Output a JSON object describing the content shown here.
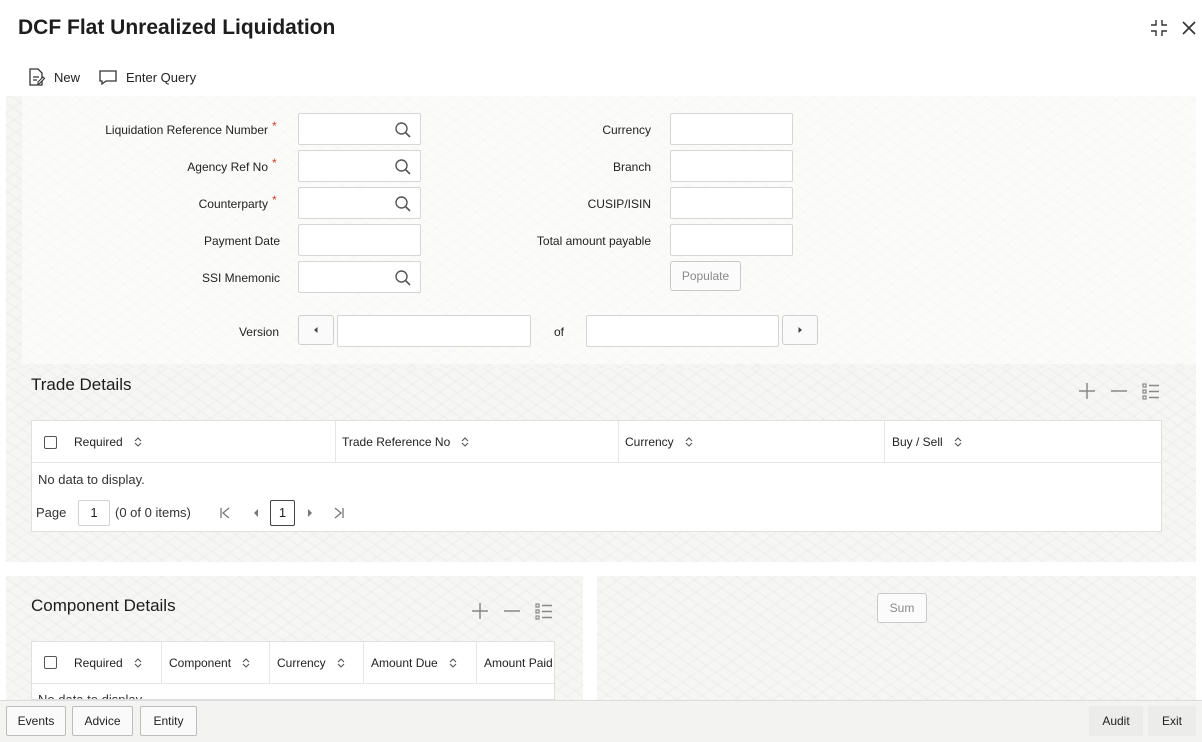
{
  "window": {
    "title": "DCF Flat Unrealized Liquidation"
  },
  "toolbar": {
    "new_label": "New",
    "enter_query_label": "Enter Query"
  },
  "form": {
    "liquidation_ref_label": "Liquidation Reference Number",
    "agency_ref_label": "Agency Ref No",
    "counterparty_label": "Counterparty",
    "payment_date_label": "Payment Date",
    "ssi_mnemonic_label": "SSI Mnemonic",
    "currency_label": "Currency",
    "branch_label": "Branch",
    "cusip_label": "CUSIP/ISIN",
    "total_amount_label": "Total amount payable",
    "required_marker": "*",
    "populate_label": "Populate",
    "version_label": "Version",
    "of_label": "of"
  },
  "trade_details": {
    "title": "Trade Details",
    "columns": [
      "Required",
      "Trade Reference No",
      "Currency",
      "Buy / Sell"
    ],
    "no_data": "No data to display.",
    "page_label": "Page",
    "page_value": "1",
    "items_text": "(0 of 0 items)",
    "current_page": "1"
  },
  "component_details": {
    "title": "Component Details",
    "columns": [
      "Required",
      "Component",
      "Currency",
      "Amount Due",
      "Amount Paid"
    ],
    "no_data": "No data to display."
  },
  "sum_label": "Sum",
  "footer": {
    "events_label": "Events",
    "advice_label": "Advice",
    "entity_label": "Entity",
    "audit_label": "Audit",
    "exit_label": "Exit"
  },
  "colors": {
    "required_star": "#d0402f",
    "panel_bg": "#f6f6f4"
  }
}
